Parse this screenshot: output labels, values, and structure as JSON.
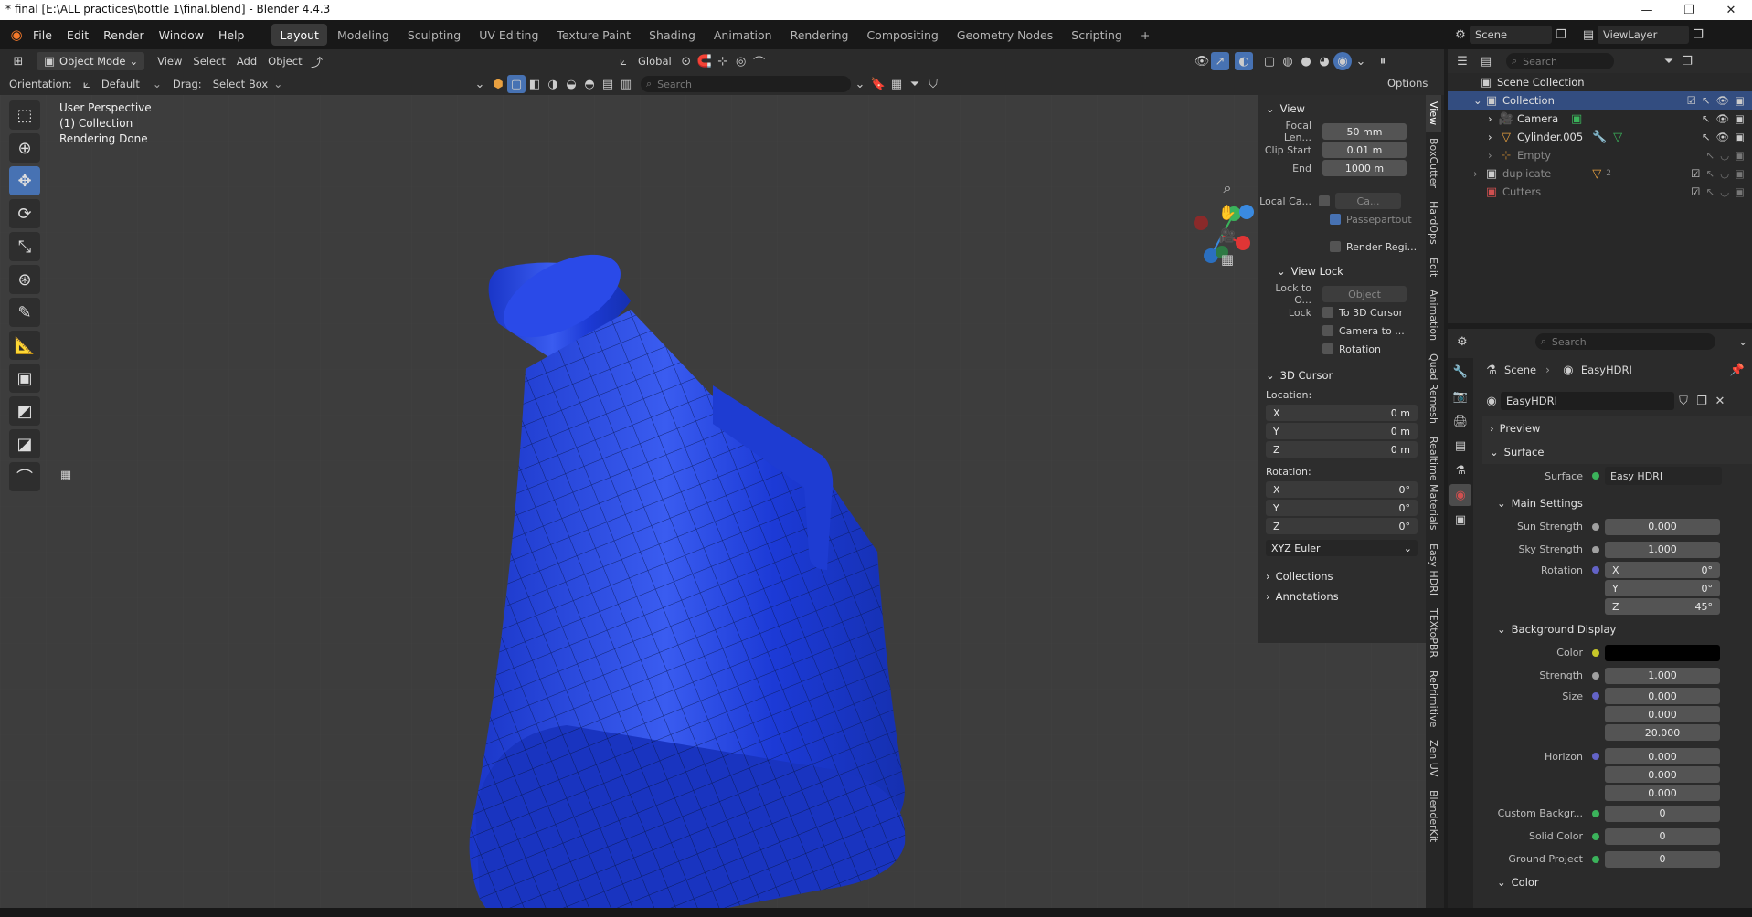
{
  "window": {
    "title": "* final [E:\\ALL practices\\bottle 1\\final.blend] - Blender 4.4.3",
    "controls": [
      "—",
      "❐",
      "✕"
    ]
  },
  "menu": {
    "items": [
      "File",
      "Edit",
      "Render",
      "Window",
      "Help"
    ],
    "workspaces": [
      "Layout",
      "Modeling",
      "Sculpting",
      "UV Editing",
      "Texture Paint",
      "Shading",
      "Animation",
      "Rendering",
      "Compositing",
      "Geometry Nodes",
      "Scripting"
    ],
    "add_tab": "+",
    "scene_label": "Scene",
    "viewlayer_label": "ViewLayer"
  },
  "viewport_header": {
    "mode": "Object Mode",
    "menus": [
      "View",
      "Select",
      "Add",
      "Object"
    ],
    "transform_orientation": "Global",
    "orientation_label": "Orientation:",
    "orientation_value": "Default",
    "drag_label": "Drag:",
    "drag_value": "Select Box",
    "search_placeholder": "Search",
    "options": "Options"
  },
  "viewport_info": {
    "line1": "User Perspective",
    "line2": "(1) Collection",
    "line3": "Rendering Done"
  },
  "npanel": {
    "view": {
      "header": "View",
      "focal_label": "Focal Len...",
      "focal_value": "50 mm",
      "clip_start_label": "Clip Start",
      "clip_start_value": "0.01 m",
      "end_label": "End",
      "end_value": "1000 m",
      "local_cam_label": "Local Ca...",
      "local_cam_value": "Ca...",
      "passepartout": "Passepartout",
      "render_region": "Render Regi..."
    },
    "view_lock": {
      "header": "View Lock",
      "lock_to_label": "Lock to O...",
      "lock_to_placeholder": "Object",
      "lock_label": "Lock",
      "opt1": "To 3D Cursor",
      "opt2": "Camera to ...",
      "opt3": "Rotation"
    },
    "cursor": {
      "header": "3D Cursor",
      "location_label": "Location:",
      "x_label": "X",
      "x": "0 m",
      "y_label": "Y",
      "y": "0 m",
      "z_label": "Z",
      "z": "0 m",
      "rotation_label": "Rotation:",
      "rx": "0°",
      "ry": "0°",
      "rz": "0°",
      "euler": "XYZ Euler"
    },
    "collections": "Collections",
    "annotations": "Annotations",
    "tabs": [
      "View",
      "BoxCutter",
      "HardOps",
      "Edit",
      "Animation",
      "Quad Remesh",
      "Realtime Materials",
      "Easy HDRI",
      "TEXtoPBR",
      "RePrimitive",
      "Zen UV",
      "BlenderKit"
    ]
  },
  "outliner": {
    "search_placeholder": "Search",
    "scene_collection": "Scene Collection",
    "rows": [
      {
        "label": "Collection",
        "indent": 1,
        "selected": true
      },
      {
        "label": "Camera",
        "indent": 2,
        "selected": false
      },
      {
        "label": "Cylinder.005",
        "indent": 2,
        "selected": false
      },
      {
        "label": "Empty",
        "indent": 2,
        "selected": false
      },
      {
        "label": "duplicate",
        "indent": 1,
        "selected": false
      },
      {
        "label": "Cutters",
        "indent": 1,
        "selected": false
      }
    ],
    "duplicate_badge": "2"
  },
  "properties": {
    "search_placeholder": "Search",
    "breadcrumb_scene": "Scene",
    "breadcrumb_world": "EasyHDRI",
    "world_name": "EasyHDRI",
    "preview": "Preview",
    "surface_header": "Surface",
    "surface_label": "Surface",
    "surface_value": "Easy HDRI",
    "main_settings": "Main Settings",
    "sun_strength_label": "Sun Strength",
    "sun_strength": "0.000",
    "sky_strength_label": "Sky Strength",
    "sky_strength": "1.000",
    "rotation_label": "Rotation",
    "rot_x_label": "X",
    "rot_x": "0°",
    "rot_y_label": "Y",
    "rot_y": "0°",
    "rot_z_label": "Z",
    "rot_z": "45°",
    "bg_display": "Background Display",
    "color_label": "Color",
    "strength_label": "Strength",
    "strength": "1.000",
    "size_label": "Size",
    "size_1": "0.000",
    "size_2": "0.000",
    "size_3": "20.000",
    "horizon_label": "Horizon",
    "horizon_1": "0.000",
    "horizon_2": "0.000",
    "horizon_3": "0.000",
    "custom_bg_label": "Custom Backgr...",
    "custom_bg": "0",
    "solid_color_label": "Solid Color",
    "solid_color": "0",
    "ground_project_label": "Ground Project",
    "ground_project": "0",
    "color_section": "Color"
  },
  "colors": {
    "accent": "#4772b3",
    "bottle": "#1f3fd6",
    "viewport_bg": "#3d3d3d"
  }
}
